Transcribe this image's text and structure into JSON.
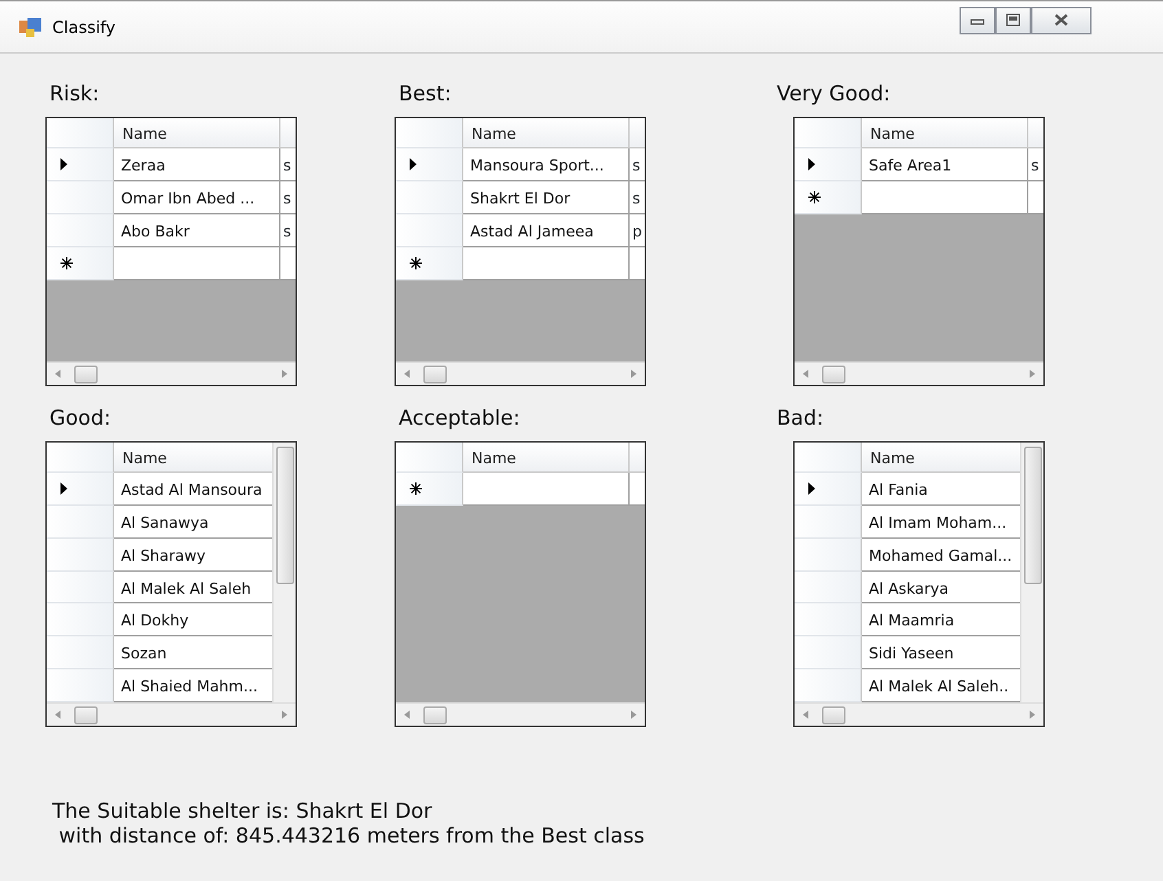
{
  "window": {
    "title": "Classify"
  },
  "grids": [
    {
      "label": "Risk:",
      "column_1": "Name",
      "vertical_scrollbar": false,
      "rows": [
        {
          "kind": "data",
          "current": true,
          "name": "Zeraa",
          "column_2": "s"
        },
        {
          "kind": "data",
          "current": false,
          "name": "Omar Ibn Abed ...",
          "column_2": "s"
        },
        {
          "kind": "data",
          "current": false,
          "name": "Abo Bakr",
          "column_2": "s"
        },
        {
          "kind": "new",
          "current": false
        }
      ]
    },
    {
      "label": "Best:",
      "column_1": "Name",
      "vertical_scrollbar": false,
      "rows": [
        {
          "kind": "data",
          "current": true,
          "name": "Mansoura Sport...",
          "column_2": "s"
        },
        {
          "kind": "data",
          "current": false,
          "name": "Shakrt El Dor",
          "column_2": "s"
        },
        {
          "kind": "data",
          "current": false,
          "name": "Astad Al Jameea",
          "column_2": "p"
        },
        {
          "kind": "new",
          "current": false
        }
      ]
    },
    {
      "label": "Very Good:",
      "column_1": "Name",
      "vertical_scrollbar": false,
      "rows": [
        {
          "kind": "data",
          "current": true,
          "name": "Safe Area1",
          "column_2": "s"
        },
        {
          "kind": "new",
          "current": false
        }
      ]
    },
    {
      "label": "Good:",
      "column_1": "Name",
      "vertical_scrollbar": true,
      "rows": [
        {
          "kind": "data",
          "current": true,
          "name": "Astad Al Mansoura"
        },
        {
          "kind": "data",
          "current": false,
          "name": "Al Sanawya"
        },
        {
          "kind": "data",
          "current": false,
          "name": "Al Sharawy"
        },
        {
          "kind": "data",
          "current": false,
          "name": "Al Malek Al Saleh"
        },
        {
          "kind": "data",
          "current": false,
          "name": "Al Dokhy"
        },
        {
          "kind": "data",
          "current": false,
          "name": "Sozan"
        },
        {
          "kind": "data",
          "current": false,
          "name": "Al Shaied Mahm..."
        }
      ]
    },
    {
      "label": "Acceptable:",
      "column_1": "Name",
      "vertical_scrollbar": false,
      "rows": [
        {
          "kind": "new",
          "current": false
        }
      ]
    },
    {
      "label": "Bad:",
      "column_1": "Name",
      "vertical_scrollbar": true,
      "rows": [
        {
          "kind": "data",
          "current": true,
          "name": "Al Fania"
        },
        {
          "kind": "data",
          "current": false,
          "name": "Al Imam Moham..."
        },
        {
          "kind": "data",
          "current": false,
          "name": "Mohamed Gamal..."
        },
        {
          "kind": "data",
          "current": false,
          "name": "Al Askarya"
        },
        {
          "kind": "data",
          "current": false,
          "name": "Al Maamria"
        },
        {
          "kind": "data",
          "current": false,
          "name": "Sidi Yaseen"
        },
        {
          "kind": "data",
          "current": false,
          "name": "Al Malek Al Saleh.."
        }
      ]
    }
  ],
  "result_lines": [
    "The Suitable shelter is: Shakrt El Dor",
    " with distance of: 845.443216 meters from the Best class"
  ]
}
